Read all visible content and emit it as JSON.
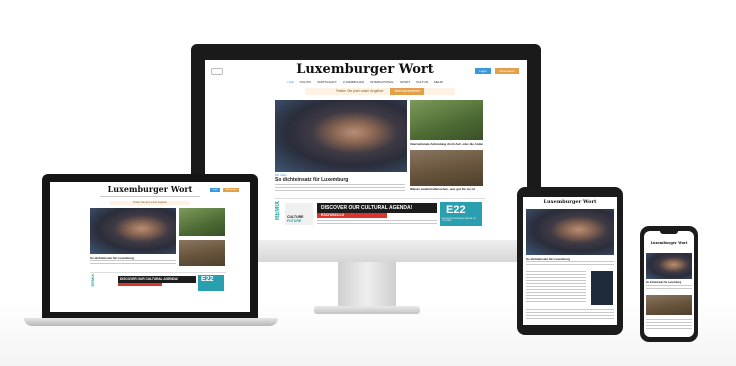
{
  "site": {
    "logo": "Luxemburger Wort",
    "nav_items": [
      "LIVE",
      "POLITIK",
      "WIRTSCHAFT",
      "LUXEMBOURG",
      "INTERNATIONAL",
      "SPORT",
      "KULTUR",
      "MEHR"
    ],
    "login_label": "Login",
    "subscribe_label": "Abonnieren",
    "promo_banner": "Testen Sie jetzt unser Angebot",
    "promo_button": "Jetzt abonnieren",
    "main_kicker": "Mit Video",
    "main_headline": "So dichteinsatz für Luxemburg",
    "side_headline": "Internationale Anbindung droht Auf- oder die Andere",
    "side2_headline": "Warum zweifeln Menschen, was gut für sie ist",
    "ad": {
      "side_word": "REMIX",
      "culture_label": "CULTURE",
      "future_label": "FUTURE",
      "headline": "DISCOVER OUR CULTURAL AGENDA!",
      "sub": "ESCH2022.LU",
      "esch_mark": "E22",
      "esch_caption": "ESCH2022 EUROPEAN CAPITAL OF CULTURE"
    }
  },
  "colors": {
    "accent_blue": "#3a9ad9",
    "accent_orange": "#e3a04a",
    "remix_teal": "#21a3a3",
    "ad_red": "#d7352e"
  }
}
